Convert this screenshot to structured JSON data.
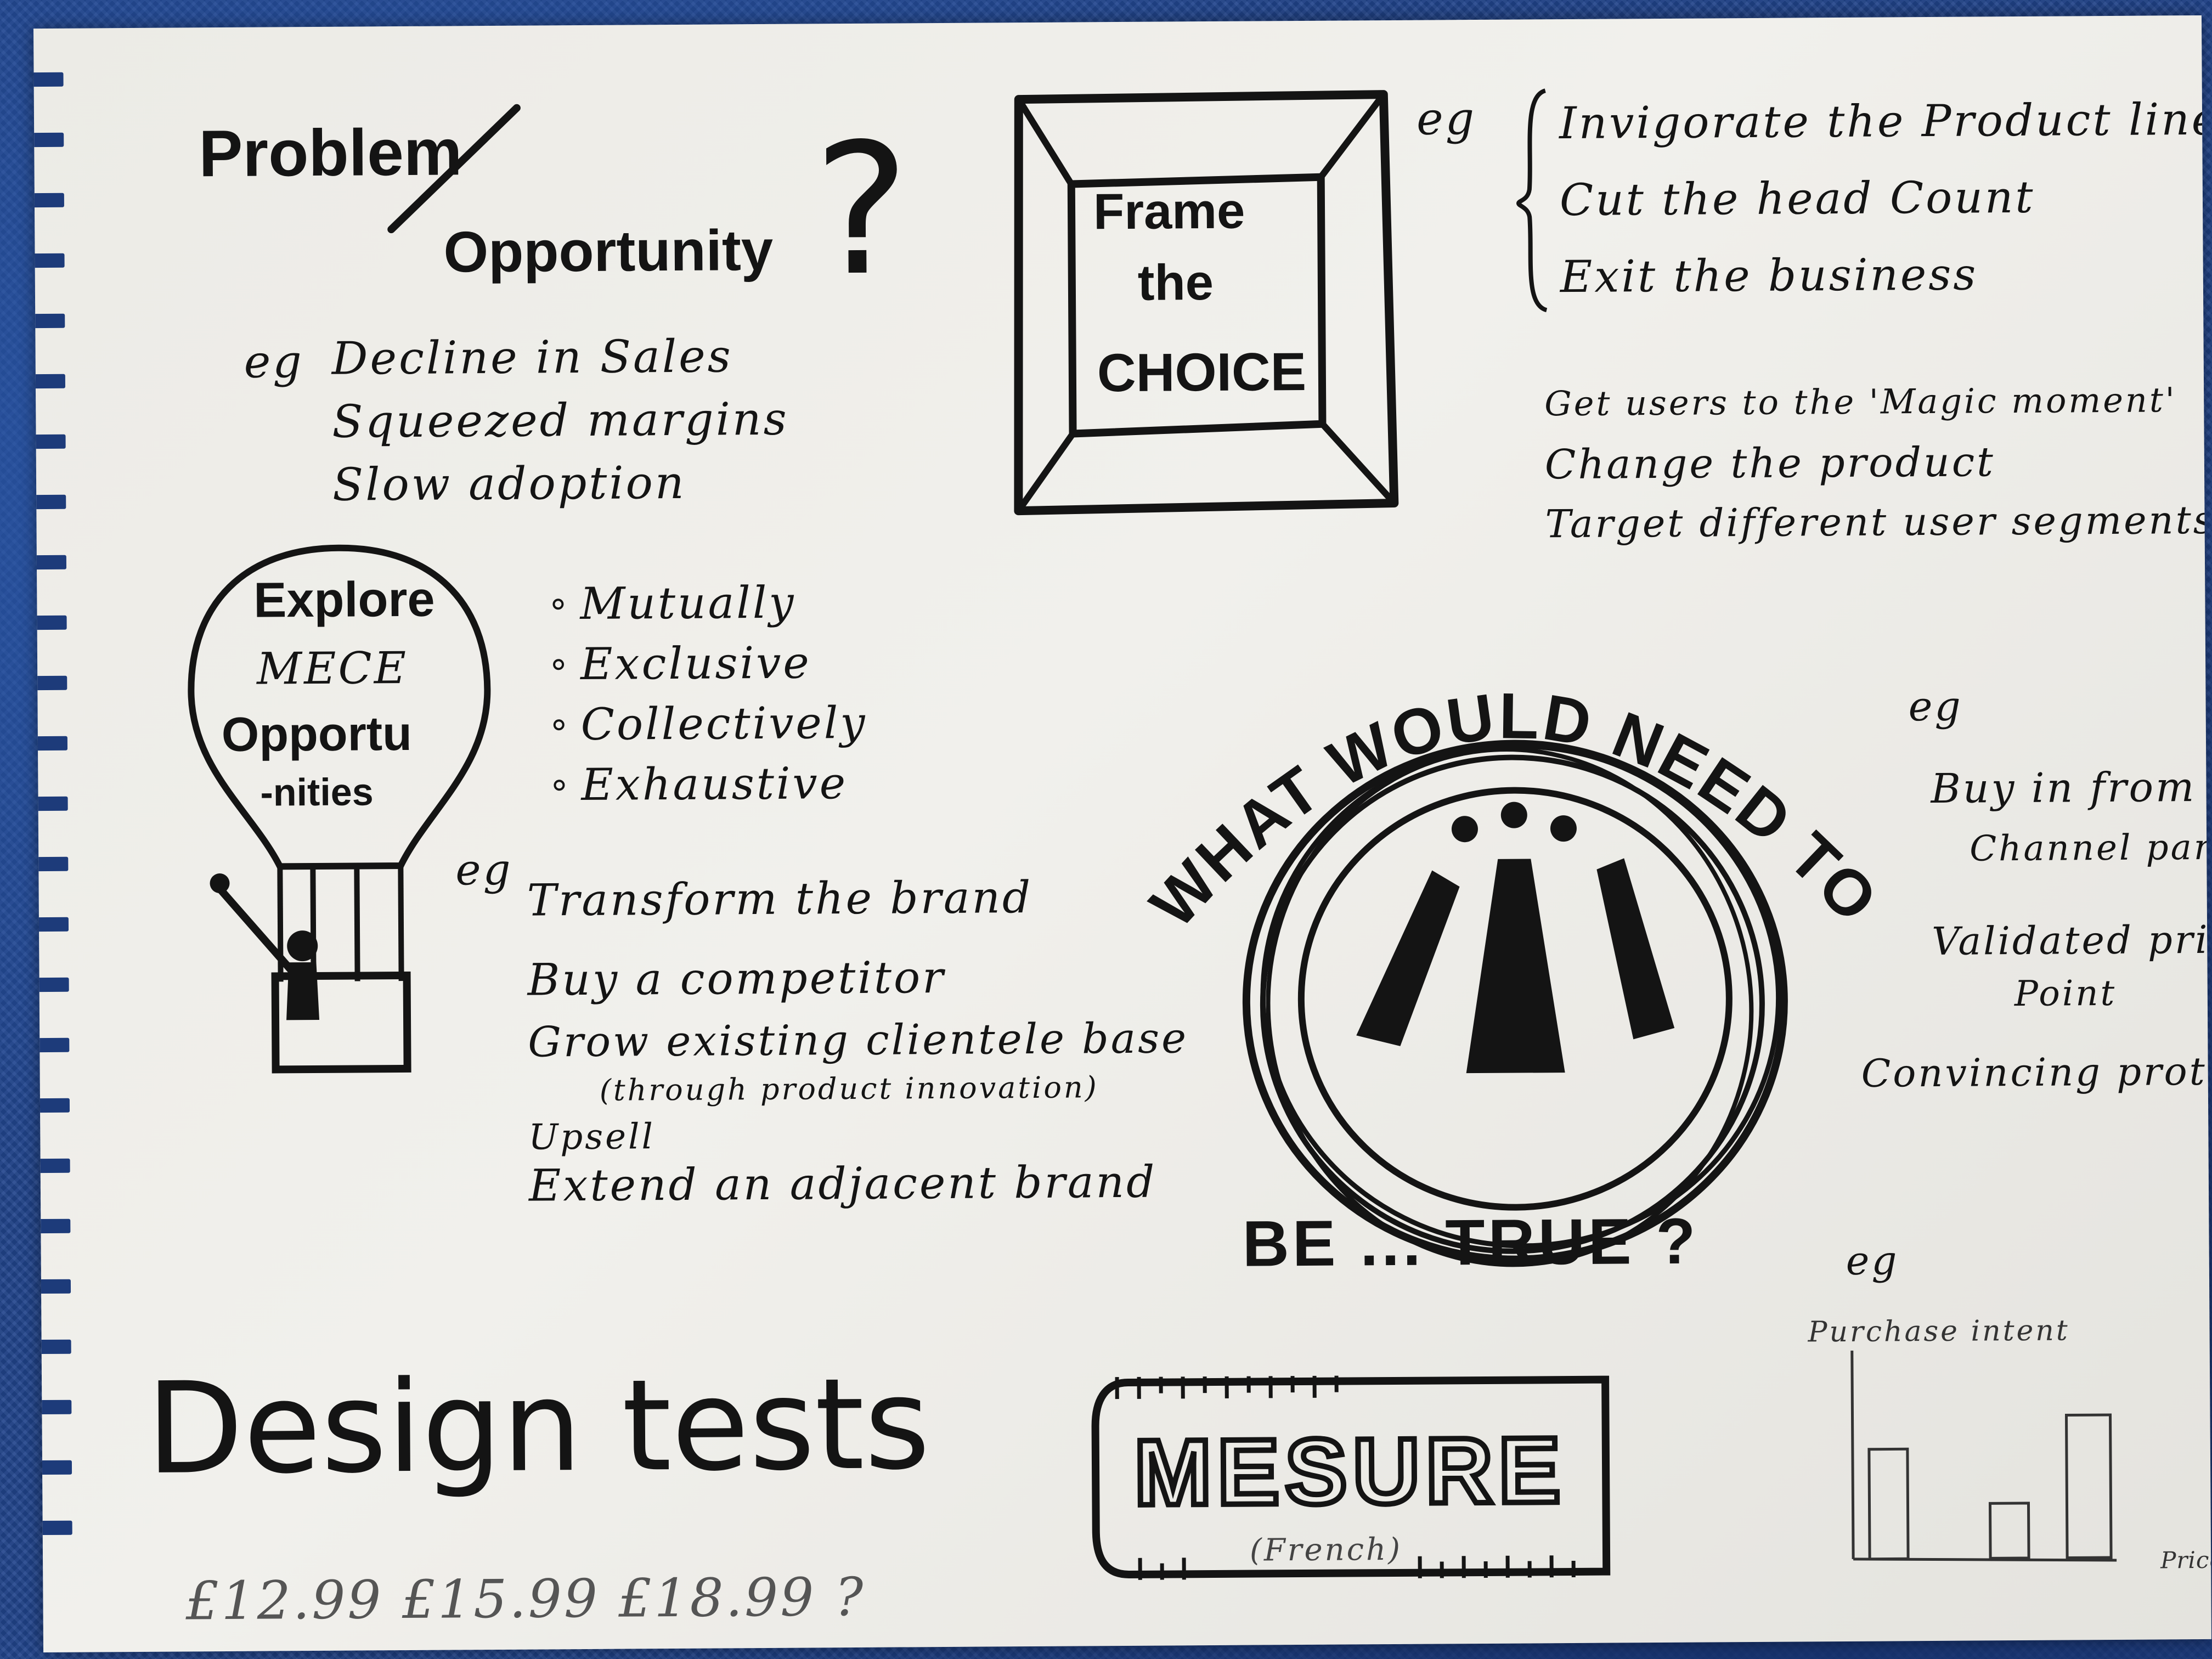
{
  "problem": {
    "word_problem": "Problem",
    "word_opportunity": "Opportunity",
    "question_mark": "?",
    "eg": "eg",
    "examples": [
      "Decline in Sales",
      "Squeezed margins",
      "Slow adoption"
    ]
  },
  "frame": {
    "line1": "Frame",
    "line2": "the",
    "line3": "CHOICE",
    "eg": "eg",
    "group1": [
      "Invigorate the Product line",
      "Cut the head Count",
      "Exit the business"
    ],
    "group2": [
      "Get users to the 'Magic moment'",
      "Change the product",
      "Target different user segments"
    ]
  },
  "explore": {
    "balloon_line1": "Explore",
    "balloon_line2": "MECE",
    "balloon_line3": "Opportu",
    "balloon_line4": "-nities",
    "mece_list": [
      "Mutually",
      "Exclusive",
      "Collectively",
      "Exhaustive"
    ],
    "eg": "eg",
    "examples": [
      "Transform the brand",
      "Buy a competitor",
      "Grow existing clientele base",
      "(through product innovation)",
      "Upsell",
      "Extend an adjacent brand"
    ]
  },
  "what_would": {
    "arc_text": "WHAT WOULD NEED TO",
    "bottom_text": "BE ... TRUE ?",
    "eg": "eg",
    "examples": [
      "Buy in from",
      "Channel partners",
      "Validated price",
      "Point",
      "Convincing prototype"
    ]
  },
  "design": {
    "title": "Design tests",
    "prices": "£12.99   £15.99   £18.99 ?"
  },
  "measure": {
    "word": "MESURE",
    "note": "(French)",
    "eg": "eg",
    "chart_ylabel": "Purchase intent",
    "chart_xlabel": "Price"
  },
  "colors": {
    "ink": "#141414",
    "paper": "#ecebe6",
    "backdrop": "#21448b"
  }
}
